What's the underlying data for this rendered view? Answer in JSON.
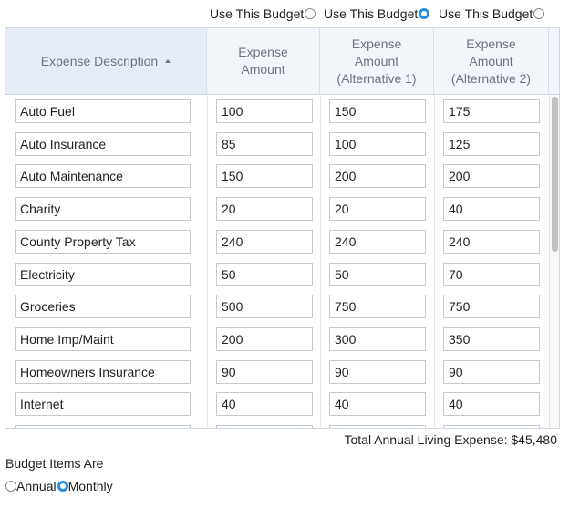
{
  "budget_selector": {
    "options": [
      {
        "label": "Use This Budget",
        "selected": false
      },
      {
        "label": "Use This Budget",
        "selected": true
      },
      {
        "label": "Use This Budget",
        "selected": false
      }
    ]
  },
  "table": {
    "headers": {
      "description": "Expense Description",
      "amount": "Expense Amount",
      "alt1": "Expense Amount (Alternative 1)",
      "alt2": "Expense Amount (Alternative 2)"
    },
    "sort": "ascending",
    "rows": [
      {
        "description": "Auto Fuel",
        "amount": "100",
        "alt1": "150",
        "alt2": "175"
      },
      {
        "description": "Auto Insurance",
        "amount": "85",
        "alt1": "100",
        "alt2": "125"
      },
      {
        "description": "Auto Maintenance",
        "amount": "150",
        "alt1": "200",
        "alt2": "200"
      },
      {
        "description": "Charity",
        "amount": "20",
        "alt1": "20",
        "alt2": "40"
      },
      {
        "description": "County Property Tax",
        "amount": "240",
        "alt1": "240",
        "alt2": "240"
      },
      {
        "description": "Electricity",
        "amount": "50",
        "alt1": "50",
        "alt2": "70"
      },
      {
        "description": "Groceries",
        "amount": "500",
        "alt1": "750",
        "alt2": "750"
      },
      {
        "description": "Home Imp/Maint",
        "amount": "200",
        "alt1": "300",
        "alt2": "350"
      },
      {
        "description": "Homeowners Insurance",
        "amount": "90",
        "alt1": "90",
        "alt2": "90"
      },
      {
        "description": "Internet",
        "amount": "40",
        "alt1": "40",
        "alt2": "40"
      },
      {
        "description": "",
        "amount": "",
        "alt1": "",
        "alt2": ""
      }
    ]
  },
  "total": {
    "label": "Total Annual Living Expense:",
    "value": "$45,480"
  },
  "budget_items": {
    "label": "Budget Items Are",
    "options": [
      {
        "label": "Annual",
        "selected": false
      },
      {
        "label": "Monthly",
        "selected": true
      }
    ]
  },
  "colors": {
    "accent": "#2b8fe0",
    "header_bg": "#f2f6fb",
    "header_text": "#6b7480",
    "border": "#cfd8e3"
  }
}
